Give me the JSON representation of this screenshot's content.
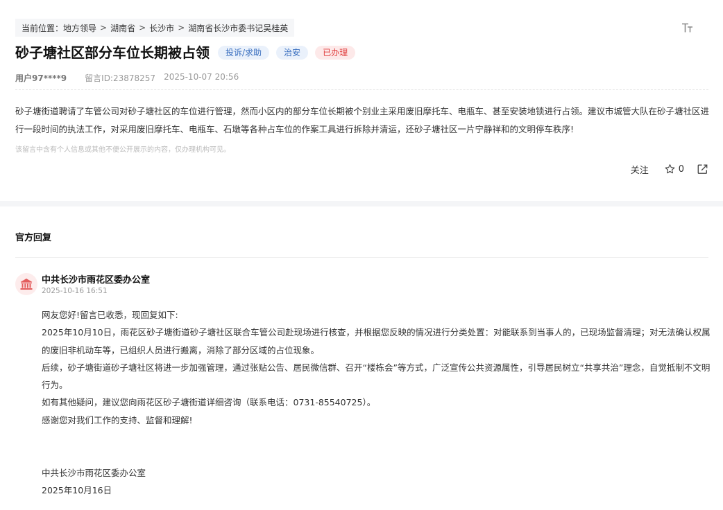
{
  "breadcrumb": {
    "label": "当前位置：",
    "items": [
      "地方领导",
      "湖南省",
      "长沙市",
      "湖南省长沙市委书记吴桂英"
    ],
    "separator": ">"
  },
  "message": {
    "title": "砂子塘社区部分车位长期被占领",
    "tags": [
      {
        "text": "投诉/求助",
        "color": "#3a6fbf",
        "bg": "#eaf1fb"
      },
      {
        "text": "治安",
        "color": "#3a6fbf",
        "bg": "#eaf1fb"
      },
      {
        "text": "已办理",
        "color": "#e03c3c",
        "bg": "#fde9e9"
      }
    ],
    "user": "用户97****9",
    "id_label": "留言ID:23878257",
    "datetime": "2025-10-07 20:56",
    "body": "砂子塘街道聘请了车管公司对砂子塘社区的车位进行管理，然而小区内的部分车位长期被个别业主采用废旧摩托车、电瓶车、甚至安装地锁进行占领。建议市城管大队在砂子塘社区进行一段时间的执法工作，对采用废旧摩托车、电瓶车、石墩等各种占车位的作案工具进行拆除并清运，还砂子塘社区一片宁静祥和的文明停车秩序!",
    "privacy_note": "该留言中含有个人信息或其他不便公开展示的内容，仅办理机构可见。",
    "follow_label": "关注",
    "star_count": "0"
  },
  "icons": {
    "font_size": "font-size-icon",
    "star": "star-icon",
    "share": "share-icon",
    "avatar": "government-building-icon"
  },
  "reply": {
    "section_title": "官方回复",
    "org": "中共长沙市雨花区委办公室",
    "date": "2025-10-16 16:51",
    "paragraphs": [
      "网友您好!留言已收悉，现回复如下:",
      "2025年10月10日，雨花区砂子塘街道砂子塘社区联合车管公司赴现场进行核查，并根据您反映的情况进行分类处置：对能联系到当事人的，已现场监督清理；对无法确认权属的废旧非机动车等，已组织人员进行搬离，消除了部分区域的占位现象。",
      "后续，砂子塘街道砂子塘社区将进一步加强管理，通过张贴公告、居民微信群、召开“楼栋会”等方式，广泛宣传公共资源属性，引导居民树立“共享共治”理念，自觉抵制不文明行为。",
      "如有其他疑问，建议您向雨花区砂子塘街道详细咨询（联系电话：0731-85540725）。",
      "感谢您对我们工作的支持、监督和理解!"
    ],
    "signature_org": "中共长沙市雨花区委办公室",
    "signature_date": "2025年10月16日"
  }
}
